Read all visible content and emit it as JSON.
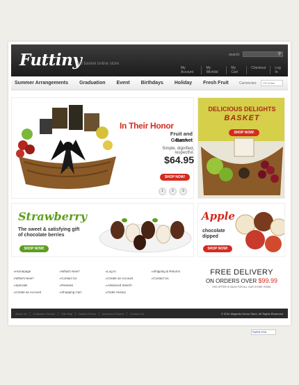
{
  "header": {
    "logo": "Futtiny",
    "tagline": "gift basket online store",
    "search_label": "search:",
    "search_value": "",
    "links": [
      "My Account",
      "My Wishlist",
      "My Cart",
      "Checkout",
      "Log In"
    ]
  },
  "nav": {
    "items": [
      "Summer Arrangements",
      "Graduation",
      "Event",
      "Birthdays",
      "Holiday",
      "Fresh Fruit"
    ],
    "currencies_label": "Currencies:",
    "currency_value": "US Dollar"
  },
  "hero": {
    "title": "In Their Honor",
    "subtitle_1": "Fruit and Gourmet",
    "subtitle_2": "Basket",
    "description": "Simple, dignified, respectful.",
    "price": "$64.95",
    "button": "SHOP NOW!",
    "pages": [
      "1",
      "2",
      "3"
    ]
  },
  "delights": {
    "title_1": "DELICIOUS DELIGHTS",
    "title_2": "BASKET",
    "button": "SHOP NOW!"
  },
  "strawberry": {
    "title": "Strawberry",
    "subtitle_1": "The sweet & satisfying gift",
    "subtitle_2": "of chocolate berries",
    "button": "SHOP NOW!"
  },
  "apple": {
    "title": "Apple",
    "subtitle_1": "chocolate",
    "subtitle_2": "dipped",
    "button": "SHOP NOW!"
  },
  "footer": {
    "col1": [
      "Homepage",
      "What's New?",
      "Specials",
      "Create an Account"
    ],
    "col2": [
      "What's New?",
      "Contact Us",
      "Reviews",
      "Shopping Cart"
    ],
    "col3": [
      "Log In",
      "Create an Account",
      "Advanced Search",
      "Order History"
    ],
    "col4": [
      "Shipping & Returns",
      "Contact Us"
    ],
    "delivery_1": "FREE DELIVERY",
    "delivery_2": "ON ORDERS OVER",
    "delivery_price": "$99.99",
    "delivery_note": "THIS OFFER IS VALID FOR ALL OUR STORE ITEMS.",
    "bar_links": [
      "About Us",
      "Customer Service",
      "Site Map",
      "Search Terms",
      "Advanced Search",
      "Contact Us"
    ],
    "copyright": "© 2011 Magento Demo Store. All Rights Reserved.",
    "payment": "PayPal VISA"
  },
  "colors": {
    "accent_red": "#d32b1f",
    "accent_green": "#5e9e1f",
    "header_dark": "#1b1b1b"
  }
}
